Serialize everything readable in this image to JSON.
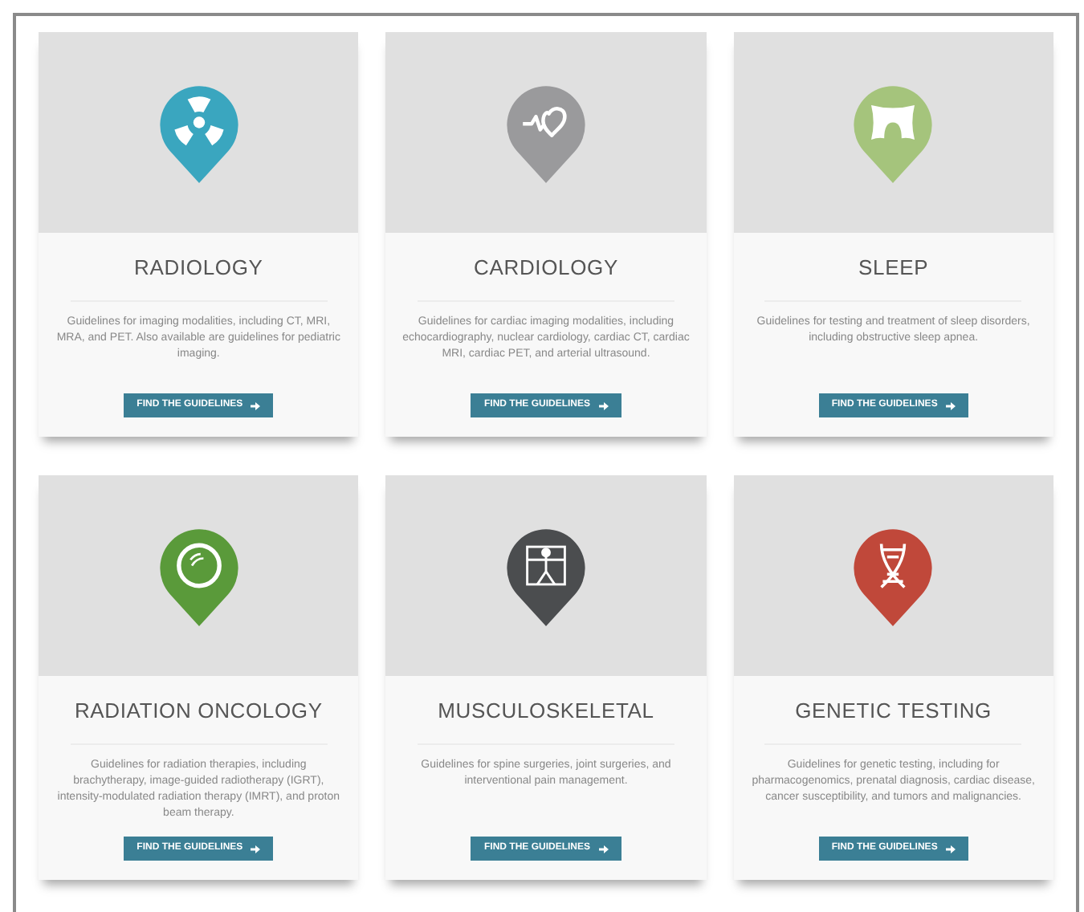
{
  "cards": [
    {
      "title": "RADIOLOGY",
      "kind": "radiation",
      "color": "#3aa6bf",
      "description": "Guidelines for imaging modalities, including CT, MRI, MRA, and PET. Also available are guidelines for pediatric imaging.",
      "button": "FIND THE GUIDELINES"
    },
    {
      "title": "CARDIOLOGY",
      "kind": "heart",
      "color": "#9a9a9c",
      "description": "Guidelines for cardiac imaging modalities, including echocardiography, nuclear cardiology, cardiac CT, cardiac MRI, cardiac PET, and arterial ultrasound.",
      "button": "FIND THE GUIDELINES"
    },
    {
      "title": "SLEEP",
      "kind": "pillow",
      "color": "#a5c47c",
      "description": "Guidelines for testing and treatment of sleep disorders, including obstructive sleep apnea.",
      "button": "FIND THE GUIDELINES"
    },
    {
      "title": "RADIATION ONCOLOGY",
      "kind": "target",
      "color": "#5a9a3a",
      "description": "Guidelines for radiation therapies, including brachytherapy, image-guided radiotherapy (IGRT), intensity-modulated radiation therapy (IMRT), and proton beam therapy.",
      "button": "FIND THE GUIDELINES"
    },
    {
      "title": "MUSCULOSKELETAL",
      "kind": "figure",
      "color": "#4b4d4f",
      "description": "Guidelines for spine surgeries, joint surgeries, and interventional pain management.",
      "button": "FIND THE GUIDELINES"
    },
    {
      "title": "GENETIC TESTING",
      "kind": "dna",
      "color": "#c0483a",
      "description": "Guidelines for genetic testing, including for pharmacogenomics, prenatal diagnosis, cardiac disease, cancer susceptibility, and tumors and malignancies.",
      "button": "FIND THE GUIDELINES"
    }
  ]
}
